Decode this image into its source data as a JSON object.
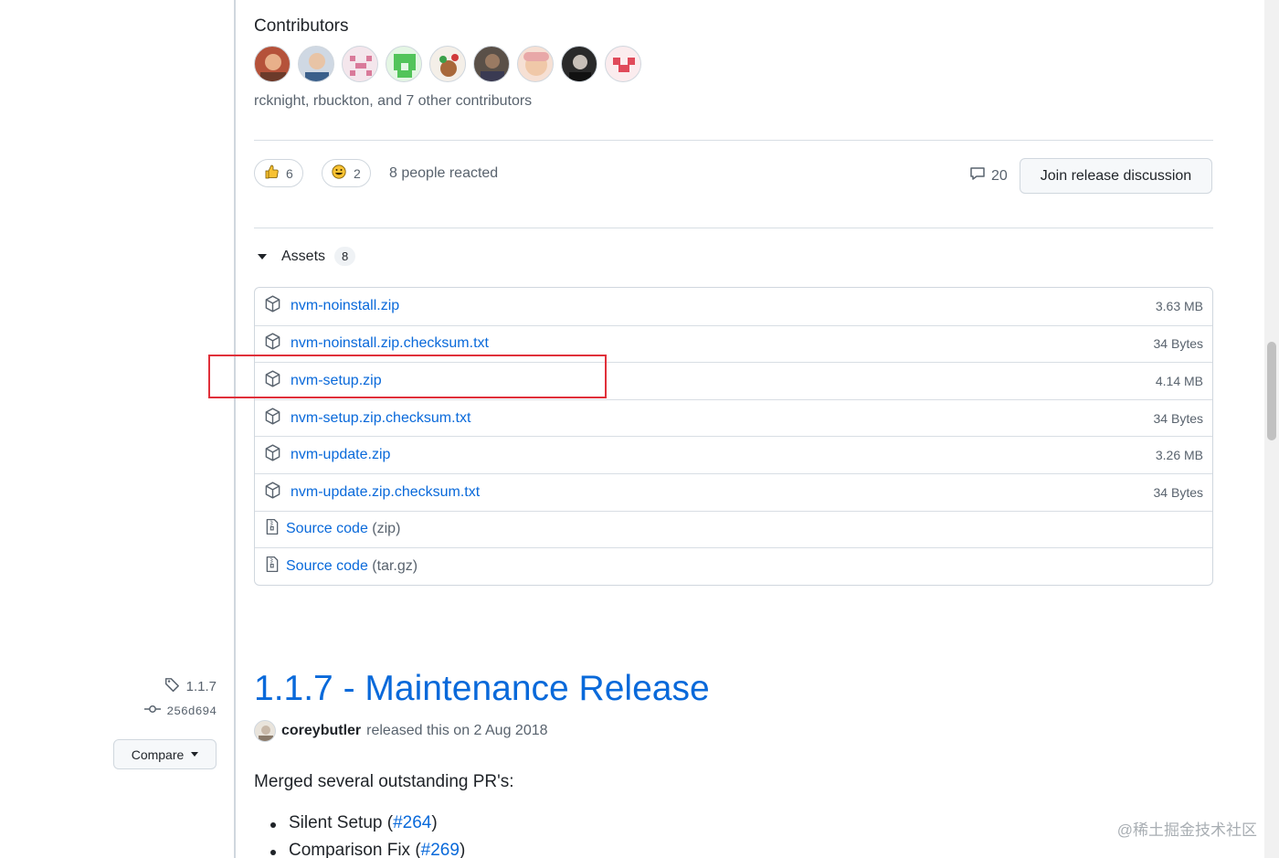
{
  "contributors": {
    "title": "Contributors",
    "summary": "rcknight, rbuckton, and 7 other contributors",
    "avatars": [
      "avatar-1",
      "avatar-2",
      "avatar-3",
      "avatar-4",
      "avatar-5",
      "avatar-6",
      "avatar-7",
      "avatar-8",
      "avatar-9"
    ]
  },
  "reactions": {
    "thumbs_up_icon": "thumbs-up-icon",
    "thumbs_up_count": "6",
    "smile_icon": "smile-icon",
    "smile_count": "2",
    "people_reacted": "8 people reacted",
    "comment_count": "20",
    "join_discussion": "Join release discussion"
  },
  "assets": {
    "label": "Assets",
    "count": "8",
    "items": [
      {
        "name": "nvm-noinstall.zip",
        "size": "3.63 MB"
      },
      {
        "name": "nvm-noinstall.zip.checksum.txt",
        "size": "34 Bytes"
      },
      {
        "name": "nvm-setup.zip",
        "size": "4.14 MB"
      },
      {
        "name": "nvm-setup.zip.checksum.txt",
        "size": "34 Bytes"
      },
      {
        "name": "nvm-update.zip",
        "size": "3.26 MB"
      },
      {
        "name": "nvm-update.zip.checksum.txt",
        "size": "34 Bytes"
      }
    ],
    "source": [
      {
        "name": "Source code",
        "ext": "(zip)"
      },
      {
        "name": "Source code",
        "ext": "(tar.gz)"
      }
    ]
  },
  "sidebar": {
    "tag": "1.1.7",
    "commit": "256d694",
    "compare": "Compare"
  },
  "release": {
    "title": "1.1.7 - Maintenance Release",
    "author": "coreybutler",
    "released_text": "released this on 2 Aug 2018",
    "intro": "Merged several outstanding PR's:",
    "items": [
      {
        "text": "Silent Setup (",
        "link": "#264",
        "close": ")"
      },
      {
        "text": "Comparison Fix (",
        "link": "#269",
        "close": ")"
      }
    ]
  },
  "watermark": "@稀土掘金技术社区",
  "colors": {
    "link": "#0969da",
    "highlight": "#e0303a"
  }
}
